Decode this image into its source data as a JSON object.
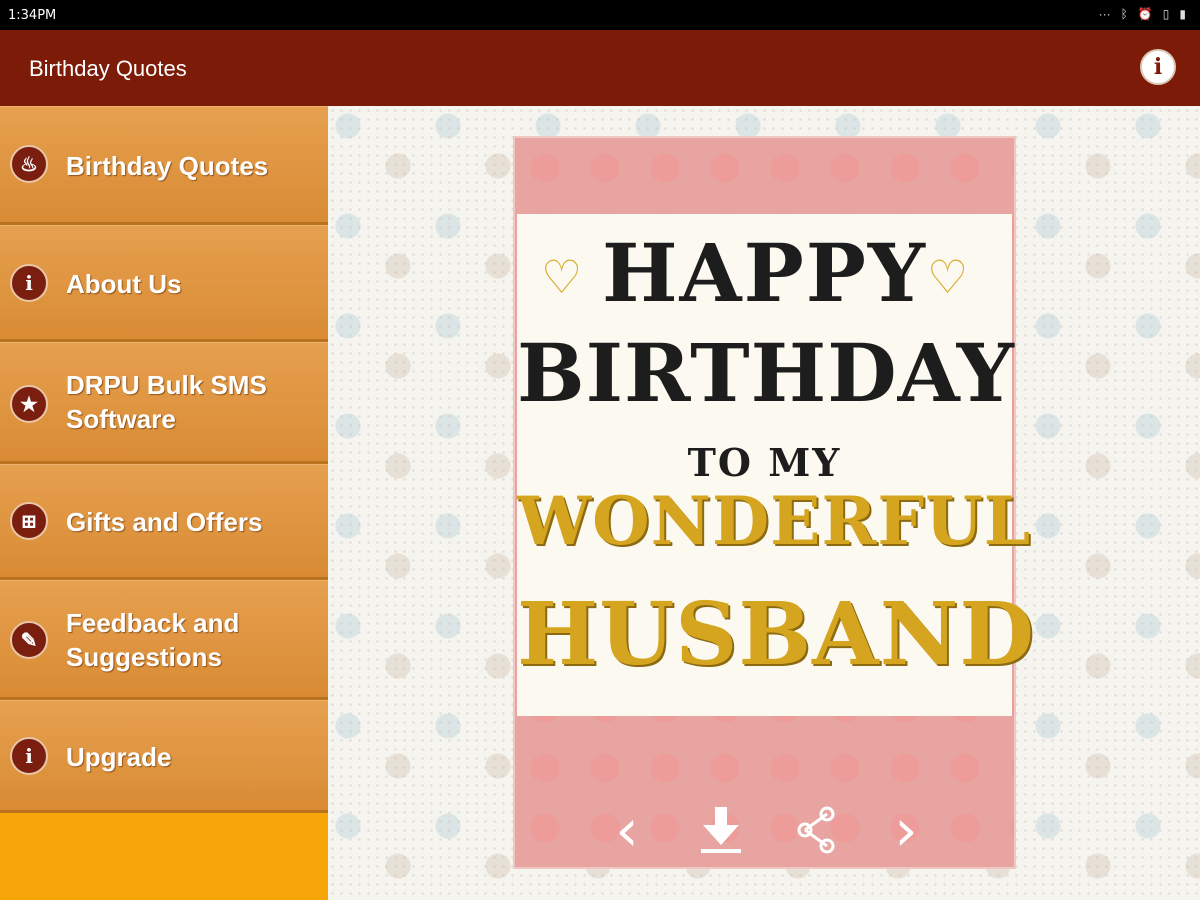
{
  "status_bar": {
    "time": "1:34PM"
  },
  "app_bar": {
    "title": "Birthday Quotes"
  },
  "drawer": {
    "items": [
      {
        "label": "Birthday Quotes",
        "icon": "cake-icon"
      },
      {
        "label": "About Us",
        "icon": "info-icon"
      },
      {
        "label": "DRPU Bulk SMS Software",
        "icon": "star-icon"
      },
      {
        "label": "Gifts and Offers",
        "icon": "gift-icon"
      },
      {
        "label": "Feedback and Suggestions",
        "icon": "feedback-icon"
      },
      {
        "label": "Upgrade",
        "icon": "info-icon"
      }
    ]
  },
  "card": {
    "line1": "HAPPY",
    "line2": "BIRTHDAY",
    "line3": "TO MY",
    "line4": "WONDERFUL",
    "line5": "HUSBAND"
  },
  "colors": {
    "app_bar": "#7d1b09",
    "drawer_item": "#e09a48",
    "drawer_footer": "#f7a508",
    "card_frame": "#e8a4a0"
  }
}
